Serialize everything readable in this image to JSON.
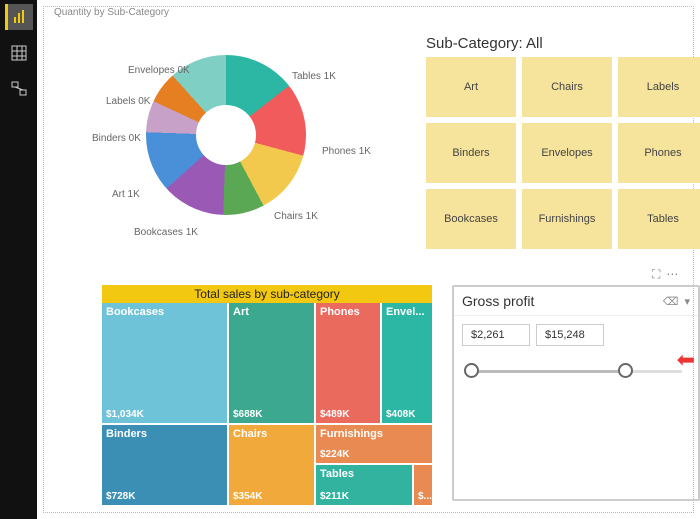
{
  "page_title": "Quantity by Sub-Category",
  "slicer_title": "Sub-Category: All",
  "slicer_items": [
    "Art",
    "Chairs",
    "Labels",
    "Binders",
    "Envelopes",
    "Phones",
    "Bookcases",
    "Furnishings",
    "Tables"
  ],
  "donut_labels": {
    "tables": "Tables 1K",
    "phones": "Phones 1K",
    "chairs": "Chairs 1K",
    "bookcases": "Bookcases 1K",
    "art": "Art 1K",
    "binders": "Binders 0K",
    "labels": "Labels 0K",
    "envelopes": "Envelopes 0K"
  },
  "treemap_title": "Total sales by sub-category",
  "treemap": {
    "bookcases": {
      "name": "Bookcases",
      "value": "$1,034K"
    },
    "binders": {
      "name": "Binders",
      "value": "$728K"
    },
    "art": {
      "name": "Art",
      "value": "$688K"
    },
    "chairs": {
      "name": "Chairs",
      "value": "$354K"
    },
    "phones": {
      "name": "Phones",
      "value": "$489K"
    },
    "envelopes": {
      "name": "Envel...",
      "value": "$408K"
    },
    "furnishings": {
      "name": "Furnishings",
      "value": "$224K"
    },
    "tables": {
      "name": "Tables",
      "value": "$211K"
    },
    "other": {
      "name": "",
      "value": "$..."
    }
  },
  "gross_profit": {
    "title": "Gross profit",
    "min": "$2,261",
    "max": "$15,248"
  },
  "chart_data": [
    {
      "type": "pie",
      "title": "Quantity by Sub-Category",
      "series": [
        {
          "name": "Tables",
          "value": 1000
        },
        {
          "name": "Phones",
          "value": 1000
        },
        {
          "name": "Chairs",
          "value": 1000
        },
        {
          "name": "Bookcases",
          "value": 1000
        },
        {
          "name": "Art",
          "value": 1000
        },
        {
          "name": "Binders",
          "value": 400
        },
        {
          "name": "Labels",
          "value": 300
        },
        {
          "name": "Envelopes",
          "value": 300
        }
      ]
    },
    {
      "type": "treemap",
      "title": "Total sales by sub-category",
      "series": [
        {
          "name": "Bookcases",
          "value": 1034000
        },
        {
          "name": "Binders",
          "value": 728000
        },
        {
          "name": "Art",
          "value": 688000
        },
        {
          "name": "Phones",
          "value": 489000
        },
        {
          "name": "Envelopes",
          "value": 408000
        },
        {
          "name": "Chairs",
          "value": 354000
        },
        {
          "name": "Furnishings",
          "value": 224000
        },
        {
          "name": "Tables",
          "value": 211000
        }
      ]
    }
  ]
}
